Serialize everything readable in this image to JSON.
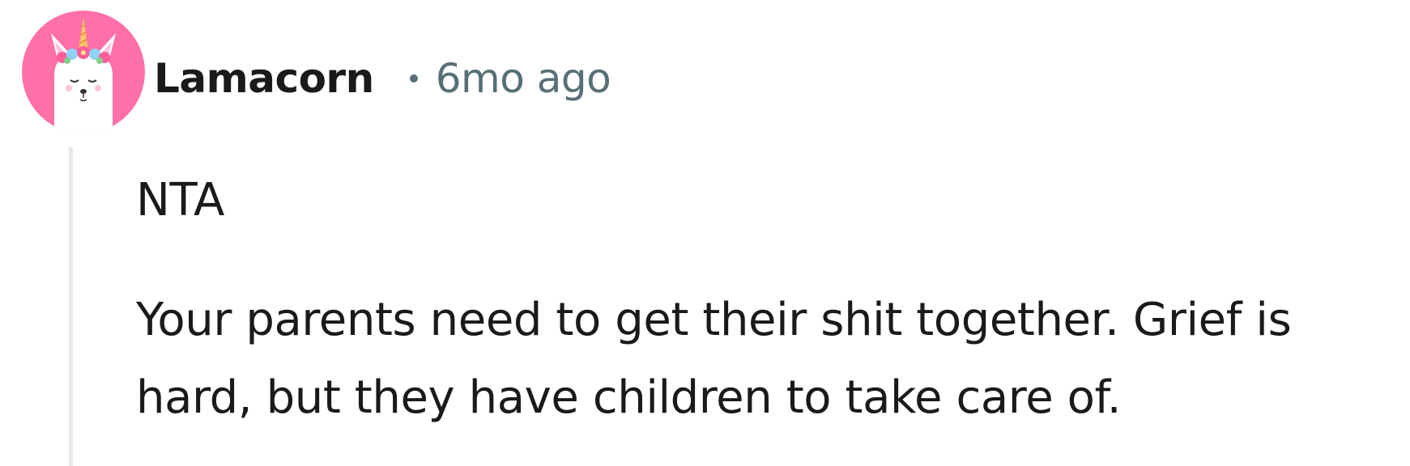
{
  "comment": {
    "author": "Lamacorn",
    "separator": "•",
    "timestamp": "6mo ago",
    "avatar_icon": "unicorn-llama-avatar-icon",
    "paragraphs": [
      "NTA",
      "Your parents need to get their shit together. Grief is hard, but they have children to take care of."
    ]
  },
  "colors": {
    "avatar_background": "#ff6fa8",
    "username": "#1a1a1b",
    "meta": "#576f76",
    "thread_line": "#e5e7e8",
    "body_text": "#1a1a1b"
  }
}
